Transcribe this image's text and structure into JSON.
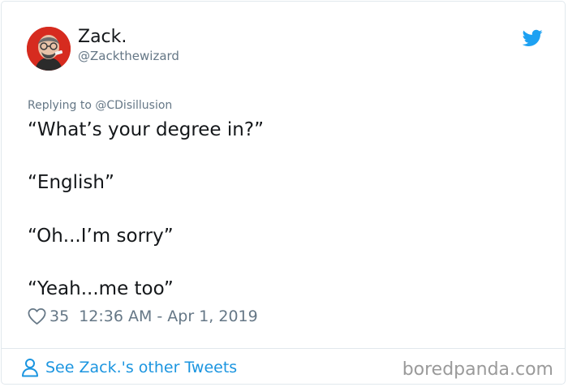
{
  "author": {
    "display_name": "Zack.",
    "handle": "@Zackthewizard",
    "avatar_icon": "avatar-photo"
  },
  "reply": {
    "text": "Replying to @CDisillusion"
  },
  "tweet": {
    "lines": [
      "“What’s your degree in?”",
      "“English”",
      "“Oh...I’m sorry”",
      "“Yeah...me too”"
    ]
  },
  "meta": {
    "likes": "35",
    "timestamp": "12:36 AM - Apr 1, 2019",
    "like_icon": "heart-icon"
  },
  "footer": {
    "see_other": "See Zack.'s other Tweets",
    "watermark": "boredpanda.com"
  },
  "colors": {
    "twitter_blue": "#1da1f2",
    "link_blue": "#1b95e0",
    "secondary_text": "#657786",
    "avatar_background": "#d62b1f"
  }
}
